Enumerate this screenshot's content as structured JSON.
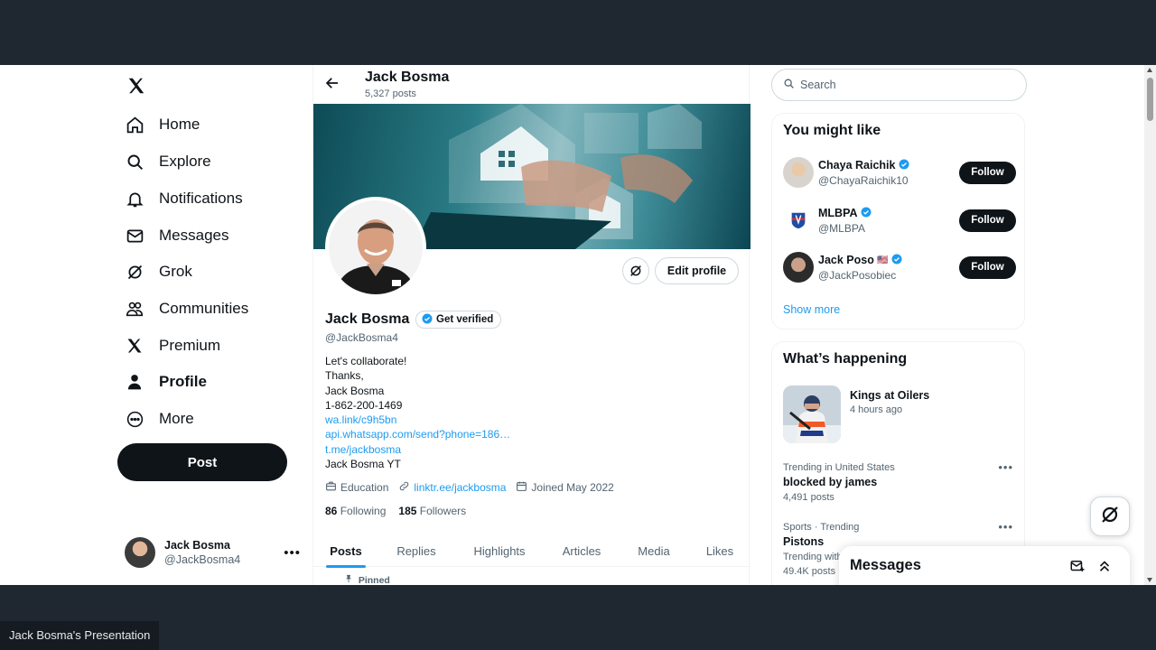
{
  "nav": {
    "items": [
      {
        "label": "Home",
        "icon": "home-icon"
      },
      {
        "label": "Explore",
        "icon": "search-icon"
      },
      {
        "label": "Notifications",
        "icon": "bell-icon"
      },
      {
        "label": "Messages",
        "icon": "envelope-icon"
      },
      {
        "label": "Grok",
        "icon": "grok-icon"
      },
      {
        "label": "Communities",
        "icon": "people-icon"
      },
      {
        "label": "Premium",
        "icon": "x-logo-icon"
      },
      {
        "label": "Profile",
        "icon": "person-icon"
      },
      {
        "label": "More",
        "icon": "more-circle-icon"
      }
    ],
    "post_label": "Post",
    "account": {
      "name": "Jack Bosma",
      "handle": "@JackBosma4"
    }
  },
  "header": {
    "name": "Jack Bosma",
    "posts": "5,327 posts"
  },
  "profile": {
    "name": "Jack Bosma",
    "get_verified": "Get verified",
    "handle": "@JackBosma4",
    "edit_label": "Edit profile",
    "bio": {
      "line1": "Let's collaborate!",
      "line2": "Thanks,",
      "line3": "Jack Bosma",
      "line4": "1-862-200-1469",
      "link1": "wa.link/c9h5bn",
      "link2": "api.whatsapp.com/send?phone=186…",
      "link3": "t.me/jackbosma",
      "line5": "Jack Bosma YT"
    },
    "meta": {
      "category": "Education",
      "website": "linktr.ee/jackbosma",
      "joined": "Joined May 2022"
    },
    "following_count": "86",
    "following_label": "Following",
    "followers_count": "185",
    "followers_label": "Followers",
    "tabs": [
      "Posts",
      "Replies",
      "Highlights",
      "Articles",
      "Media",
      "Likes"
    ],
    "pinned_label": "Pinned"
  },
  "sidebar": {
    "search_placeholder": "Search",
    "you_might_like": {
      "title": "You might like",
      "suggestions": [
        {
          "name": "Chaya Raichik",
          "handle": "@ChayaRaichik10",
          "follow": "Follow"
        },
        {
          "name": "MLBPA",
          "handle": "@MLBPA",
          "follow": "Follow"
        },
        {
          "name": "Jack Poso",
          "flag": "🇺🇸",
          "handle": "@JackPosobiec",
          "follow": "Follow"
        }
      ],
      "show_more": "Show more"
    },
    "whats_happening": {
      "title": "What’s happening",
      "event": {
        "title": "Kings at Oilers",
        "time": "4 hours ago"
      },
      "trends": [
        {
          "context": "Trending in United States",
          "title": "blocked by james",
          "count": "4,491 posts"
        },
        {
          "context": "Sports · Trending",
          "title": "Pistons",
          "count": "49.4K posts",
          "extra": "Trending with"
        }
      ]
    }
  },
  "messages_drawer": {
    "title": "Messages"
  },
  "caption": "Jack Bosma's Presentation",
  "colors": {
    "accent": "#1d9bf0",
    "text": "#0f1419",
    "muted": "#536471",
    "dark_frame": "#1f2731"
  }
}
